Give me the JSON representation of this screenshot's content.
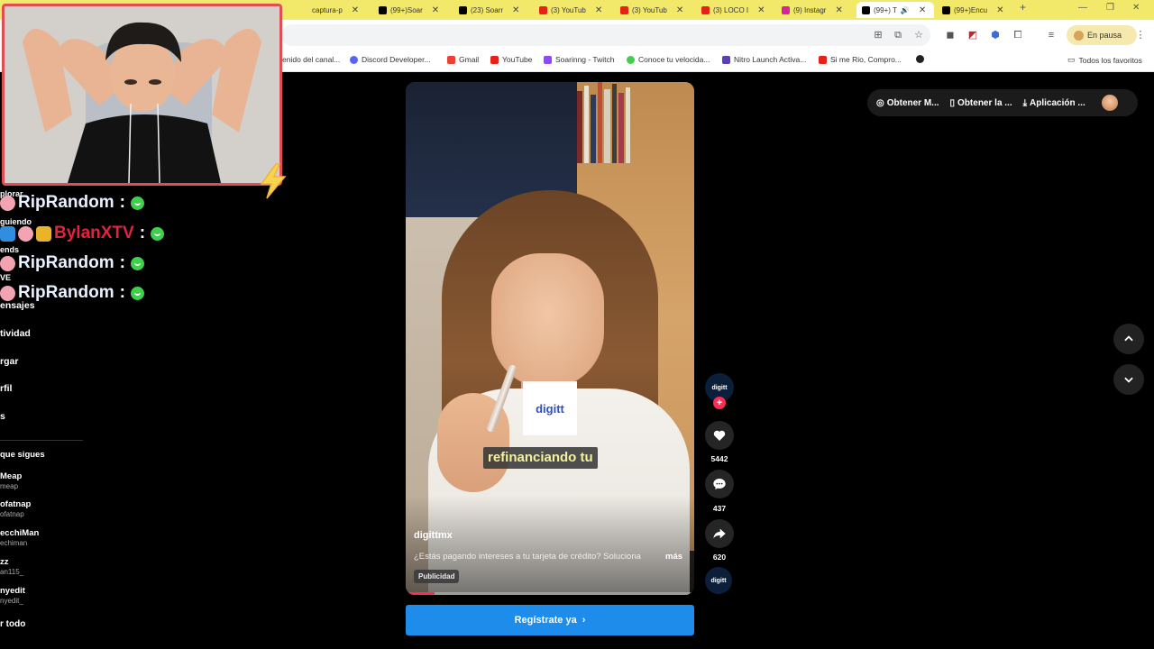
{
  "browser": {
    "tabs": [
      {
        "label": "captura-p",
        "color": "#f2e96a"
      },
      {
        "label": "(99+)Soar",
        "color": "#000000"
      },
      {
        "label": "(23) Soarr",
        "color": "#000000"
      },
      {
        "label": "(3) YouTub",
        "color": "#e62117"
      },
      {
        "label": "(3) YouTub",
        "color": "#e62117"
      },
      {
        "label": "(3) LOCO I",
        "color": "#e62117"
      },
      {
        "label": "(9) Instagr",
        "color": "#d6249f"
      },
      {
        "label": "(99+) T",
        "color": "#000000"
      },
      {
        "label": "(99+)Encu",
        "color": "#000000"
      }
    ],
    "pause_label": "En pausa",
    "bookmarks": [
      {
        "label": "enido del canal...",
        "color": ""
      },
      {
        "label": "Discord Developer...",
        "color": "#5865f2"
      },
      {
        "label": "Gmail",
        "color": "#ea4335"
      },
      {
        "label": "YouTube",
        "color": "#e62117"
      },
      {
        "label": "Soarinng - Twitch",
        "color": "#9146ff"
      },
      {
        "label": "Conoce tu velocida...",
        "color": "#3ecf4c"
      },
      {
        "label": "Nitro Launch Activa...",
        "color": "#5c3fb5"
      },
      {
        "label": "Si me Rio, Compro...",
        "color": "#e62117"
      }
    ],
    "all_bookmarks_label": "Todos los favoritos"
  },
  "sidebar": {
    "items": [
      "plorar",
      "guiendo",
      "ends",
      "VE",
      "ensajes",
      "tividad",
      "rgar",
      "rfil",
      "s"
    ],
    "following_title": "que sigues",
    "accounts": [
      {
        "name": "Meap",
        "handle": "meap"
      },
      {
        "name": "ofatnap",
        "handle": "ofatnap"
      },
      {
        "name": "ecchiMan",
        "handle": "echiman"
      },
      {
        "name": "zz",
        "handle": "an115_"
      },
      {
        "name": "nyedit",
        "handle": "nyedit_"
      }
    ],
    "see_all": "r todo"
  },
  "chat": [
    {
      "user": "RipRandom",
      "color": "#e8f1ff"
    },
    {
      "user": "BylanXTV",
      "color": "#e3233b"
    },
    {
      "user": "RipRandom",
      "color": "#e8f1ff"
    },
    {
      "user": "RipRandom",
      "color": "#e8f1ff"
    }
  ],
  "chat_colon": ":",
  "top_actions": {
    "coins": "Obtener M...",
    "get_app": "Obtener la ...",
    "app": "Aplicación ..."
  },
  "video": {
    "logo_text": "digitt",
    "caption": "refinanciando tu",
    "author": "digittmx",
    "description": "¿Estás pagando intereses a tu tarjeta de crédito? Soluciona",
    "more": "más",
    "ad_label": "Publicidad",
    "progress": 0.1
  },
  "rail": {
    "avatar_text": "digitt",
    "plus": "+",
    "likes": "5442",
    "comments": "437",
    "shares": "620"
  },
  "cta_label": "Regístrate ya",
  "colors": {
    "accent": "#1d8ceb",
    "tiktok_red": "#fe2c55",
    "webcam_border": "#e04e55",
    "tabbar": "#f2e96a"
  }
}
